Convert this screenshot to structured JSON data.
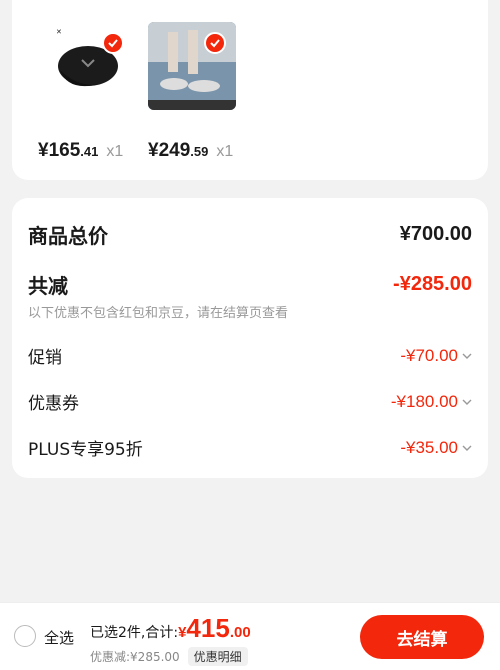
{
  "products": [
    {
      "price_int": "¥165",
      "price_dec": ".41",
      "qty": "x1",
      "image": "black-cap-image"
    },
    {
      "price_int": "¥249",
      "price_dec": ".59",
      "qty": "x1",
      "image": "running-shoes-image"
    }
  ],
  "summary": {
    "total_label": "商品总价",
    "total_value": "¥700.00",
    "reduce_label": "共减",
    "reduce_value": "-¥285.00",
    "note": "以下优惠不包含红包和京豆，请在结算页查看",
    "items": [
      {
        "label": "促销",
        "value": "-¥70.00"
      },
      {
        "label": "优惠券",
        "value": "-¥180.00"
      },
      {
        "label": "PLUS专享95折",
        "value": "-¥35.00"
      }
    ]
  },
  "bottom": {
    "select_all": "全选",
    "selected_text": "已选2件,合计:",
    "total_sym": "¥",
    "total_int": "415",
    "total_dec": ".00",
    "discount_text": "优惠减:¥285.00",
    "detail_label": "优惠明细",
    "checkout_label": "去结算"
  },
  "colors": {
    "accent": "#f2270c",
    "background": "#f2f2f2"
  }
}
